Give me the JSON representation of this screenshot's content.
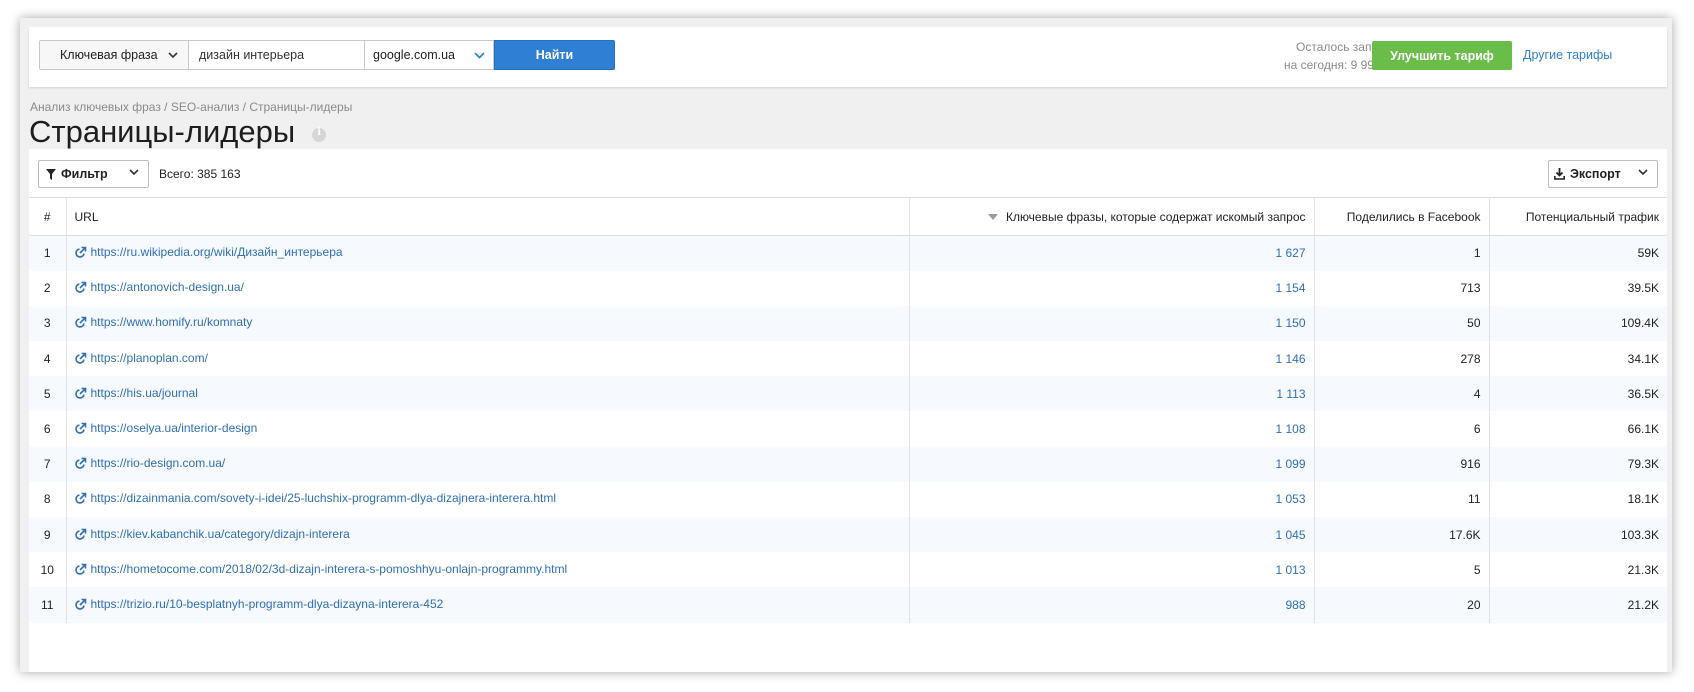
{
  "search": {
    "type_label": "Ключевая фраза",
    "query_value": "дизайн интерьера",
    "engine_value": "google.com.ua",
    "find_button": "Найти"
  },
  "quota": {
    "line1": "Осталось запросов",
    "line2": "на сегодня: 9 999 978"
  },
  "header": {
    "upgrade_button": "Улучшить тариф",
    "other_tariffs_link": "Другие тарифы"
  },
  "breadcrumb": "Анализ ключевых фраз / SEO-анализ / Страницы-лидеры",
  "page_title": "Страницы-лидеры",
  "toolbar": {
    "filter_label": "Фильтр",
    "total_label": "Всего: 385 163",
    "export_label": "Экспорт"
  },
  "table": {
    "columns": {
      "num": "#",
      "url": "URL",
      "keywords": "Ключевые фразы, которые содержат искомый запрос",
      "facebook": "Поделились в Facebook",
      "traffic": "Потенциальный трафик"
    },
    "rows": [
      {
        "num": "1",
        "url": "https://ru.wikipedia.org/wiki/Дизайн_интерьера",
        "keywords": "1 627",
        "facebook": "1",
        "traffic": "59K"
      },
      {
        "num": "2",
        "url": "https://antonovich-design.ua/",
        "keywords": "1 154",
        "facebook": "713",
        "traffic": "39.5K"
      },
      {
        "num": "3",
        "url": "https://www.homify.ru/komnaty",
        "keywords": "1 150",
        "facebook": "50",
        "traffic": "109.4K"
      },
      {
        "num": "4",
        "url": "https://planoplan.com/",
        "keywords": "1 146",
        "facebook": "278",
        "traffic": "34.1K"
      },
      {
        "num": "5",
        "url": "https://his.ua/journal",
        "keywords": "1 113",
        "facebook": "4",
        "traffic": "36.5K"
      },
      {
        "num": "6",
        "url": "https://oselya.ua/interior-design",
        "keywords": "1 108",
        "facebook": "6",
        "traffic": "66.1K"
      },
      {
        "num": "7",
        "url": "https://rio-design.com.ua/",
        "keywords": "1 099",
        "facebook": "916",
        "traffic": "79.3K"
      },
      {
        "num": "8",
        "url": "https://dizainmania.com/sovety-i-idei/25-luchshix-programm-dlya-dizajnera-interera.html",
        "keywords": "1 053",
        "facebook": "11",
        "traffic": "18.1K"
      },
      {
        "num": "9",
        "url": "https://kiev.kabanchik.ua/category/dizajn-interera",
        "keywords": "1 045",
        "facebook": "17.6K",
        "traffic": "103.3K"
      },
      {
        "num": "10",
        "url": "https://hometocome.com/2018/02/3d-dizajn-interera-s-pomoshhyu-onlajn-programmy.html",
        "keywords": "1 013",
        "facebook": "5",
        "traffic": "21.3K"
      },
      {
        "num": "11",
        "url": "https://trizio.ru/10-besplatnyh-programm-dlya-dizayna-interera-452",
        "keywords": "988",
        "facebook": "20",
        "traffic": "21.2K"
      }
    ]
  },
  "colors": {
    "accent_blue": "#2f7fd5",
    "link_blue": "#2f6fb8",
    "upgrade_green": "#6bbd4a",
    "row_stripe": "#f6f9fd"
  },
  "icons": [
    "chevron-down-icon",
    "filter-icon",
    "download-icon",
    "external-link-icon",
    "sort-desc-icon",
    "info-icon"
  ]
}
